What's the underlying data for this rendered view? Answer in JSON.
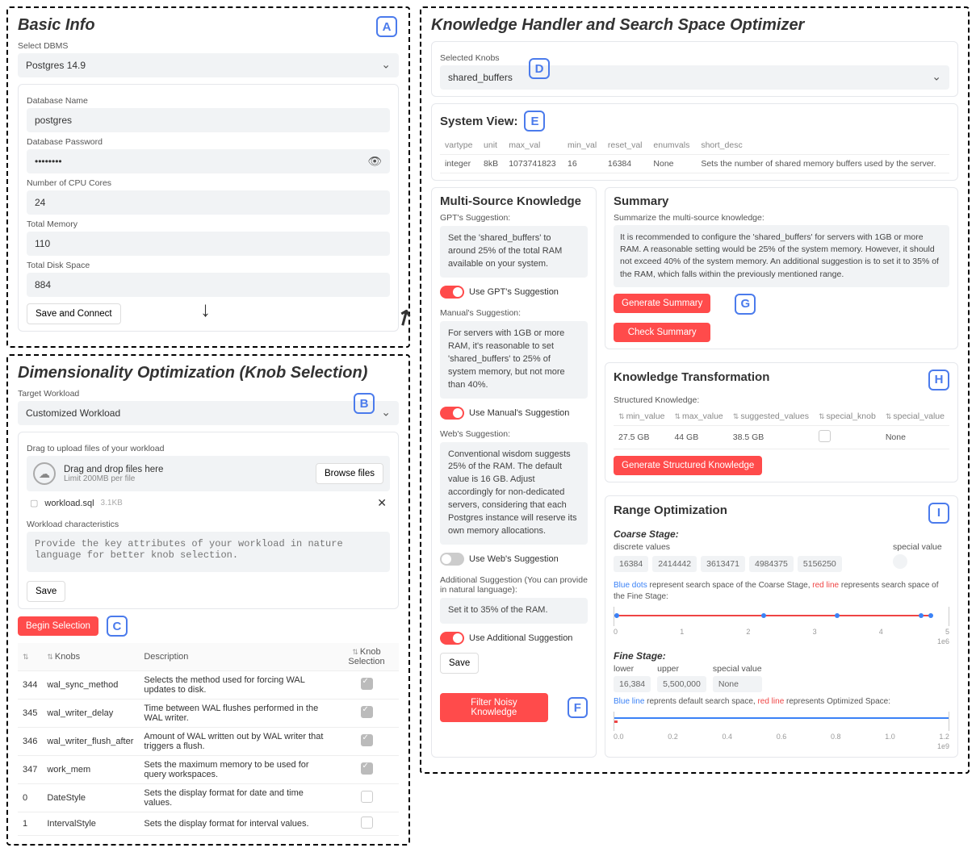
{
  "basicInfo": {
    "title": "Basic Info",
    "badge": "A",
    "dbmsLabel": "Select DBMS",
    "dbmsValue": "Postgres 14.9",
    "dbNameLabel": "Database Name",
    "dbNameValue": "postgres",
    "dbPassLabel": "Database Password",
    "dbPassValue": "••••••••",
    "cpuLabel": "Number of CPU Cores",
    "cpuValue": "24",
    "memLabel": "Total Memory",
    "memValue": "110",
    "diskLabel": "Total Disk Space",
    "diskValue": "884",
    "saveBtn": "Save and Connect"
  },
  "dimOpt": {
    "title": "Dimensionality Optimization (Knob Selection)",
    "badgeB": "B",
    "badgeC": "C",
    "targetLabel": "Target Workload",
    "targetValue": "Customized Workload",
    "uploadHint": "Drag to upload files of your workload",
    "dropTitle": "Drag and drop files here",
    "dropLimit": "Limit 200MB per file",
    "browseBtn": "Browse files",
    "fileName": "workload.sql",
    "fileSize": "3.1KB",
    "charLabel": "Workload characteristics",
    "charPlaceholder": "Provide the key attributes of your workload in nature language for better knob selection.",
    "saveBtn": "Save",
    "beginBtn": "Begin Selection",
    "cols": {
      "idx": "",
      "knobs": "Knobs",
      "desc": "Description",
      "sel": "Knob Selection"
    },
    "rows": [
      {
        "i": "344",
        "k": "wal_sync_method",
        "d": "Selects the method used for forcing WAL updates to disk.",
        "on": true
      },
      {
        "i": "345",
        "k": "wal_writer_delay",
        "d": "Time between WAL flushes performed in the WAL writer.",
        "on": true
      },
      {
        "i": "346",
        "k": "wal_writer_flush_after",
        "d": "Amount of WAL written out by WAL writer that triggers a flush.",
        "on": true
      },
      {
        "i": "347",
        "k": "work_mem",
        "d": "Sets the maximum memory to be used for query workspaces.",
        "on": true
      },
      {
        "i": "0",
        "k": "DateStyle",
        "d": "Sets the display format for date and time values.",
        "on": false
      },
      {
        "i": "1",
        "k": "IntervalStyle",
        "d": "Sets the display format for interval values.",
        "on": false
      }
    ]
  },
  "kh": {
    "title": "Knowledge Handler and Search Space Optimizer",
    "selKnobsLabel": "Selected Knobs",
    "selKnobsValue": "shared_buffers",
    "badgeD": "D",
    "sysView": {
      "title": "System View:",
      "badge": "E",
      "cols": [
        "vartype",
        "unit",
        "max_val",
        "min_val",
        "reset_val",
        "enumvals",
        "short_desc"
      ],
      "row": [
        "integer",
        "8kB",
        "1073741823",
        "16",
        "16384",
        "None",
        "Sets the number of shared memory buffers used by the server."
      ]
    },
    "multi": {
      "title": "Multi-Source Knowledge",
      "gptLabel": "GPT's Suggestion:",
      "gptText": "Set the 'shared_buffers' to around 25% of the total RAM available on your system.",
      "gptToggle": "Use GPT's Suggestion",
      "manLabel": "Manual's Suggestion:",
      "manText": "For servers with 1GB or more RAM, it's reasonable to set 'shared_buffers' to 25% of system memory, but not more than 40%.",
      "manToggle": "Use Manual's Suggestion",
      "webLabel": "Web's Suggestion:",
      "webText": "Conventional wisdom suggests 25% of the RAM. The default value is 16 GB. Adjust accordingly for non-dedicated servers, considering that each Postgres instance will reserve its own memory allocations.",
      "webToggle": "Use Web's Suggestion",
      "addLabel": "Additional Suggestion (You can provide in natural language):",
      "addText": "Set it to 35% of the RAM.",
      "addToggle": "Use Additional Suggestion",
      "saveBtn": "Save",
      "filterBtn": "Filter Noisy Knowledge",
      "badgeF": "F"
    },
    "summary": {
      "title": "Summary",
      "sub": "Summarize the multi-source knowledge:",
      "text": "It is recommended to configure the 'shared_buffers' for servers with 1GB or more RAM. A reasonable setting would be 25% of the system memory. However, it should not exceed 40% of the system memory. An additional suggestion is to set it to 35% of the RAM, which falls within the previously mentioned range.",
      "genBtn": "Generate Summary",
      "chkBtn": "Check Summary",
      "badgeG": "G"
    },
    "ktrans": {
      "title": "Knowledge Transformation",
      "sub": "Structured Knowledge:",
      "badgeH": "H",
      "cols": [
        "min_value",
        "max_value",
        "suggested_values",
        "special_knob",
        "special_value"
      ],
      "row": [
        "27.5 GB",
        "44 GB",
        "38.5 GB",
        "",
        "None"
      ],
      "genBtn": "Generate Structured Knowledge"
    },
    "range": {
      "title": "Range Optimization",
      "badgeI": "I",
      "coarseLabel": "Coarse Stage:",
      "discreteLabel": "discrete values",
      "spValLabel": "special value",
      "discrete": [
        "16384",
        "2414442",
        "3613471",
        "4984375",
        "5156250"
      ],
      "coarseNote1": "Blue dots",
      "coarseNote2": " represent search space of the Coarse Stage, ",
      "coarseNote3": "red line",
      "coarseNote4": " represents search space of the Fine Stage:",
      "coarseAxis": [
        "0",
        "1",
        "2",
        "3",
        "4",
        "5"
      ],
      "coarseAxisUnit": "1e6",
      "fineLabel": "Fine Stage:",
      "lowerLabel": "lower",
      "upperLabel": "upper",
      "lower": "16,384",
      "upper": "5,500,000",
      "spVal": "None",
      "fineNote1": "Blue line",
      "fineNote2": " reprents default search space, ",
      "fineNote3": "red line",
      "fineNote4": " represents Optimized Space:",
      "fineAxis": [
        "0.0",
        "0.2",
        "0.4",
        "0.6",
        "0.8",
        "1.0",
        "1.2"
      ],
      "fineAxisUnit": "1e9"
    }
  }
}
